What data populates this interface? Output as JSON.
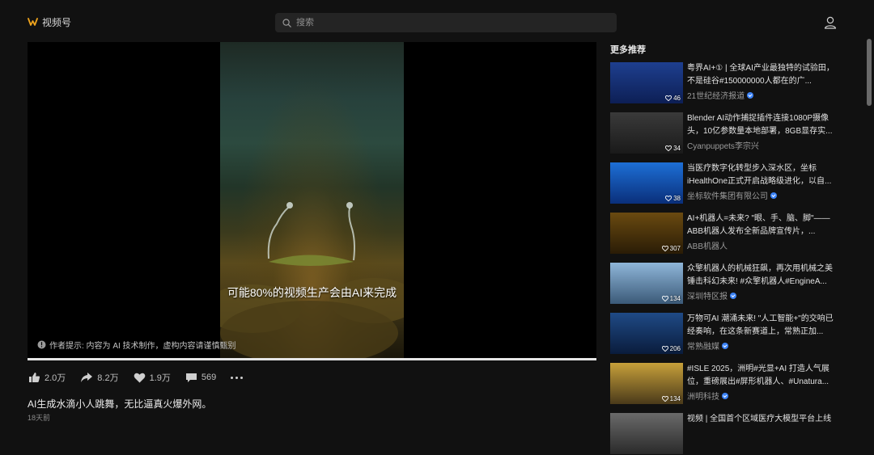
{
  "header": {
    "brand": "视频号",
    "search_placeholder": "搜索"
  },
  "player": {
    "subtitle": "可能80%的视频生产会由AI来完成",
    "ai_notice": "作者提示: 内容为 AI 技术制作，虚构内容请谨慎甄别",
    "progress": 1.0
  },
  "actions": {
    "like": "2.0万",
    "share": "8.2万",
    "favorite": "1.9万",
    "comment": "569"
  },
  "video": {
    "title": "AI生成水滴小人跳舞，无比逼真火爆外网。",
    "time": "18天前"
  },
  "sidebar": {
    "heading": "更多推荐",
    "items": [
      {
        "title": "粤界AI+① | 全球AI产业最独特的试验田，不是硅谷#150000000人都在的广...",
        "author": "21世纪经济报道",
        "verified": true,
        "likes": "46",
        "thumb_top": "#1e3f8f",
        "thumb_bottom": "#0d1f55"
      },
      {
        "title": "Blender AI动作捕捉插件连接1080P摄像头，10亿参数量本地部署，8GB显存实...",
        "author": "Cyanpuppets李宗兴",
        "verified": false,
        "likes": "34",
        "thumb_top": "#3a3a3a",
        "thumb_bottom": "#1a1a1a"
      },
      {
        "title": "当医疗数字化转型步入深水区，坐标iHealthOne正式开启战略级进化，以自...",
        "author": "坐标软件集团有限公司",
        "verified": true,
        "likes": "38",
        "thumb_top": "#1d6fd6",
        "thumb_bottom": "#0a2f7a"
      },
      {
        "title": "AI+机器人=未来? \"眼、手、脑、脚\"——ABB机器人发布全新品牌宣传片，...",
        "author": "ABB机器人",
        "verified": false,
        "likes": "307",
        "thumb_top": "#6a4a10",
        "thumb_bottom": "#2a1c06"
      },
      {
        "title": "众擎机器人的机械狂飙，再次用机械之美锤击科幻未来! #众擎机器人#EngineA...",
        "author": "深圳特区报",
        "verified": true,
        "likes": "134",
        "thumb_top": "#8fb6d9",
        "thumb_bottom": "#3b5a78"
      },
      {
        "title": "万物可AI 潮涌未来! \"人工智能+\"的交响已经奏响，在这条新赛道上，常熟正加...",
        "author": "常熟融媒",
        "verified": true,
        "likes": "206",
        "thumb_top": "#1f4a86",
        "thumb_bottom": "#0a1c3c"
      },
      {
        "title": "#ISLE 2025，洲明#光显+AI 打造人气展位，重磅展出#屏形机器人、#Unatura...",
        "author": "洲明科技",
        "verified": true,
        "likes": "134",
        "thumb_top": "#c7a03a",
        "thumb_bottom": "#4a3a1a"
      },
      {
        "title": "视频 | 全国首个区域医疗大模型平台上线",
        "author": "",
        "verified": false,
        "likes": "",
        "thumb_top": "#6a6a6a",
        "thumb_bottom": "#2a2a2a"
      }
    ]
  }
}
